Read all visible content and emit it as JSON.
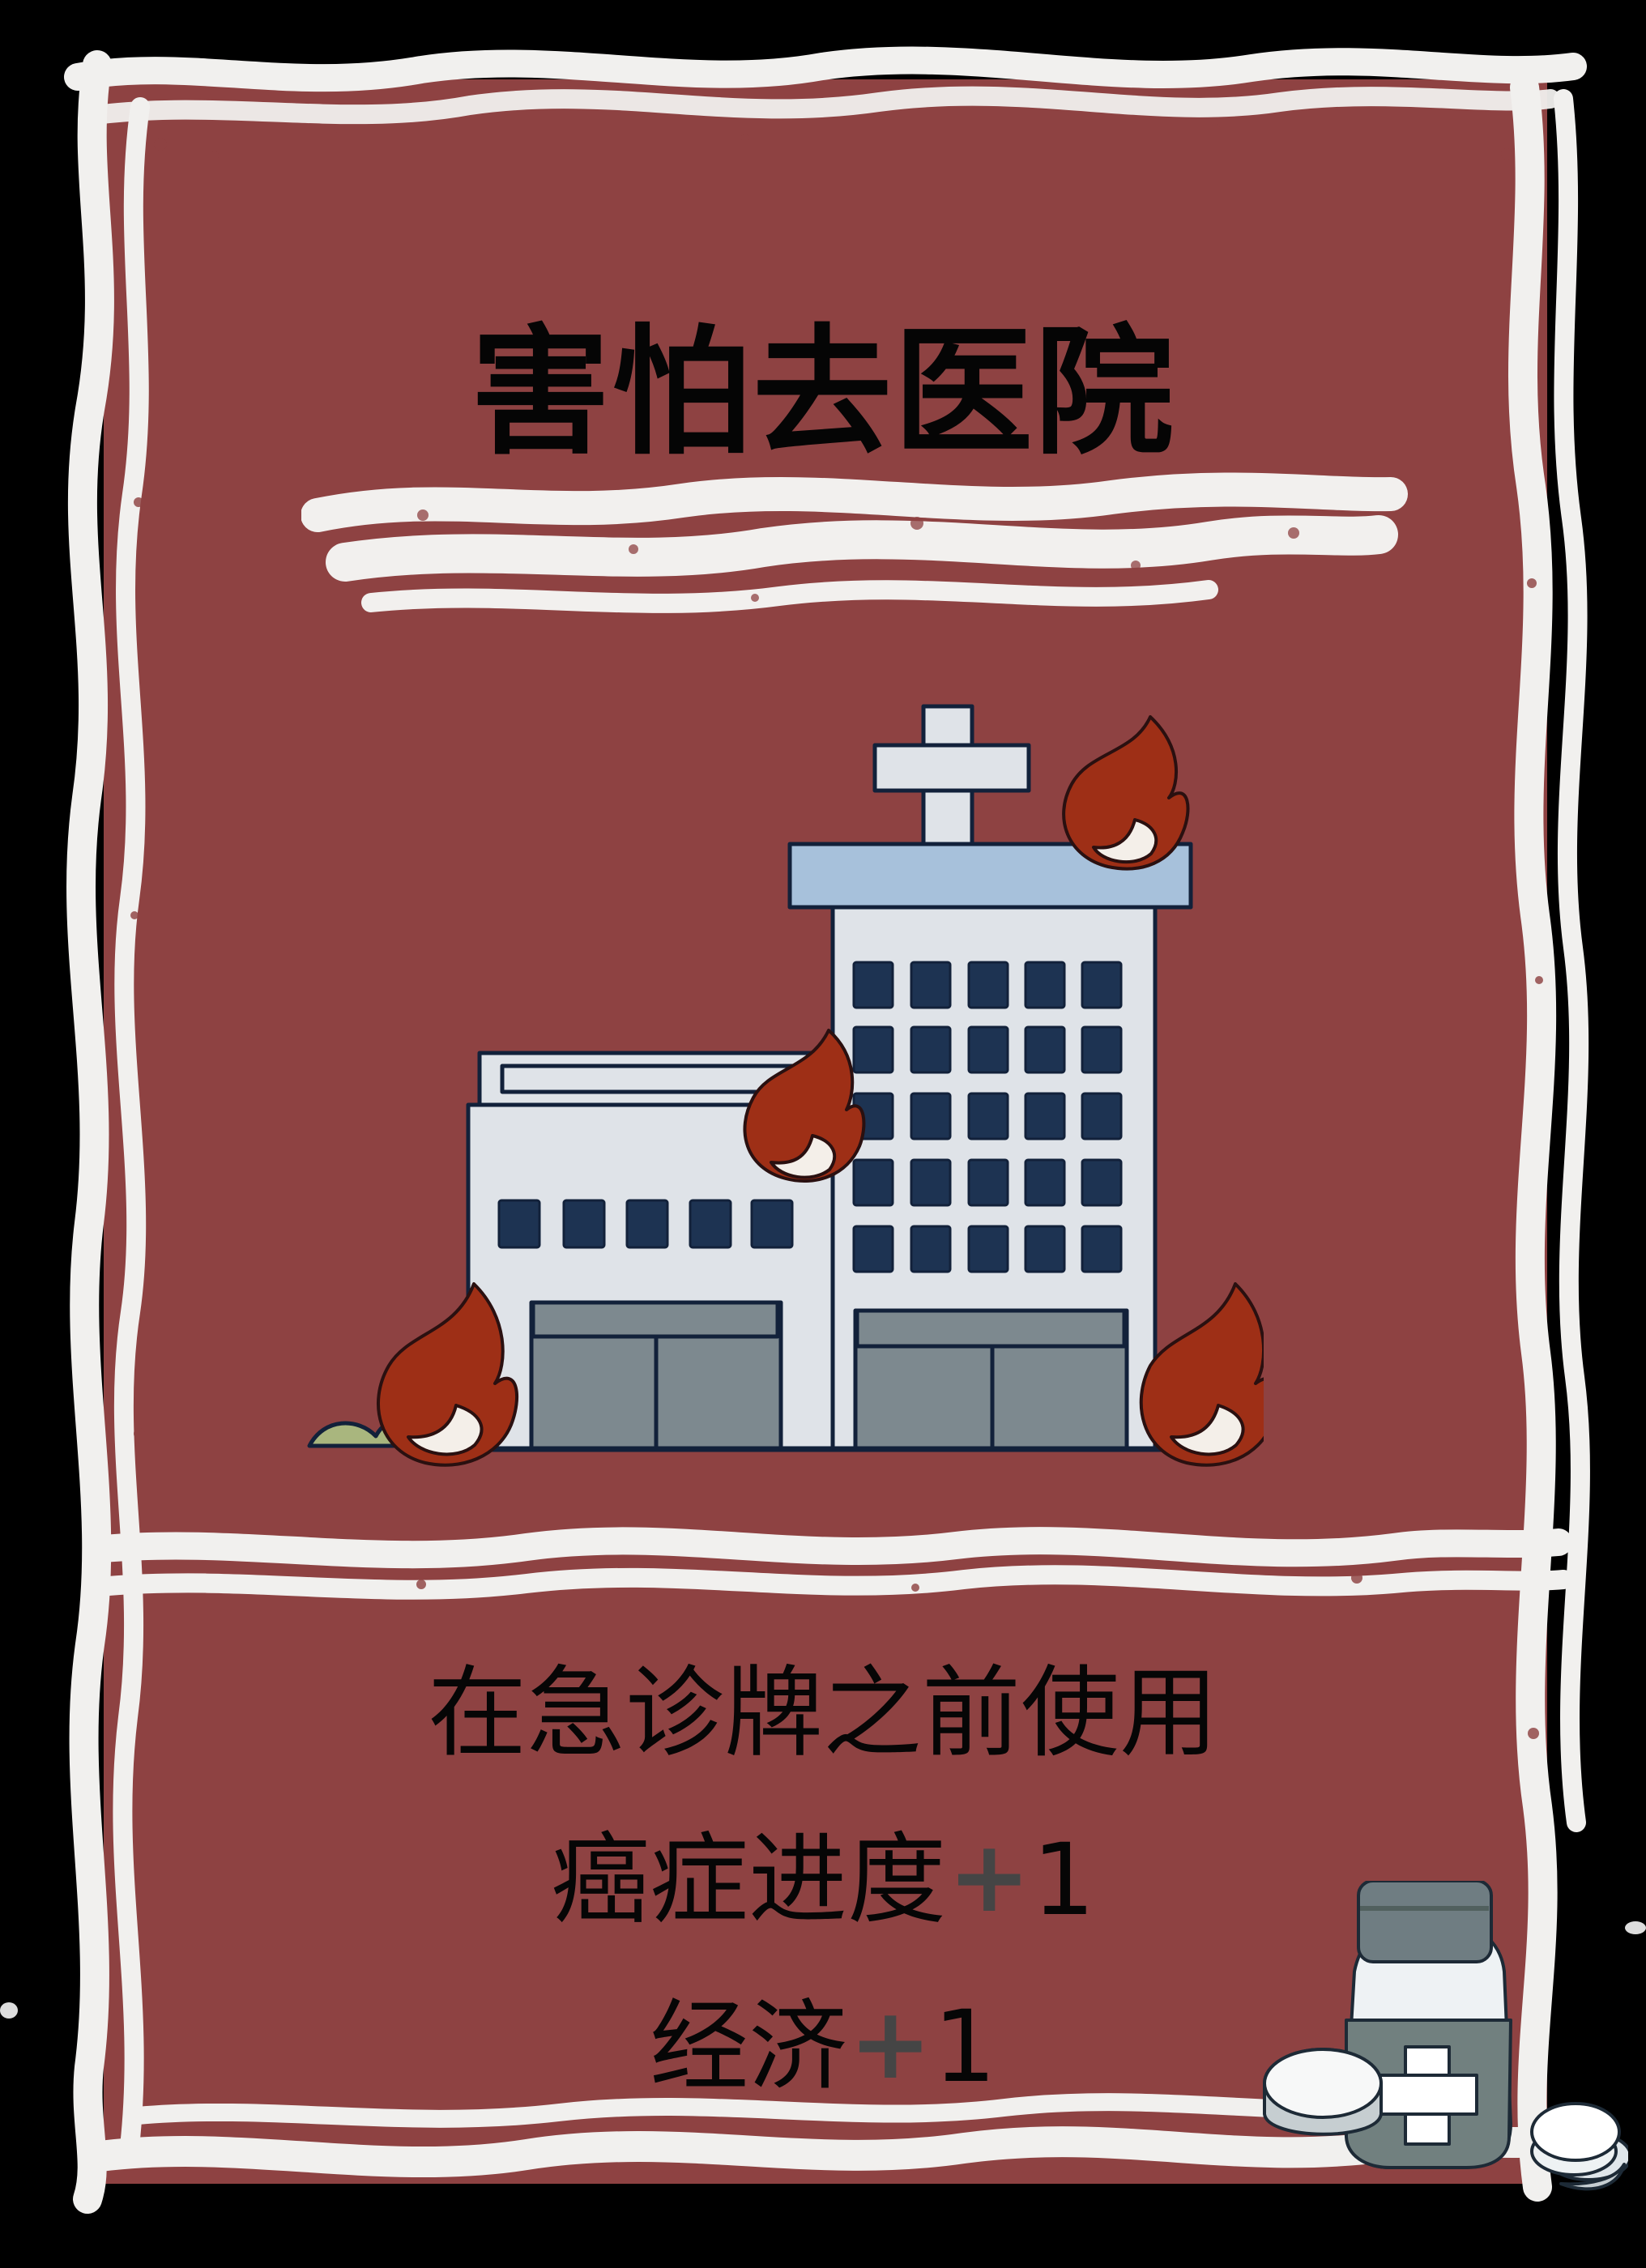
{
  "card": {
    "title": "害怕去医院",
    "illustration_icon": "burning-hospital-icon",
    "effects": [
      {
        "text": "在急诊牌之前使用",
        "symbol": "",
        "value": ""
      },
      {
        "text": "癌症进度",
        "symbol": "+",
        "value": "1"
      },
      {
        "text": "经济",
        "symbol": "+",
        "value": "1"
      }
    ],
    "decoration_icon": "medicine-bottle-pills-icon"
  },
  "colors": {
    "page_background": "#000000",
    "card_background": "#8e4242",
    "chalk_border": "#f2f0ee",
    "text": "#050505",
    "plus_symbol": "#454545",
    "building": "#dfe3e8",
    "building_roof": "#a7c1db",
    "window": "#1d3352",
    "flame": "#9e2f16"
  }
}
